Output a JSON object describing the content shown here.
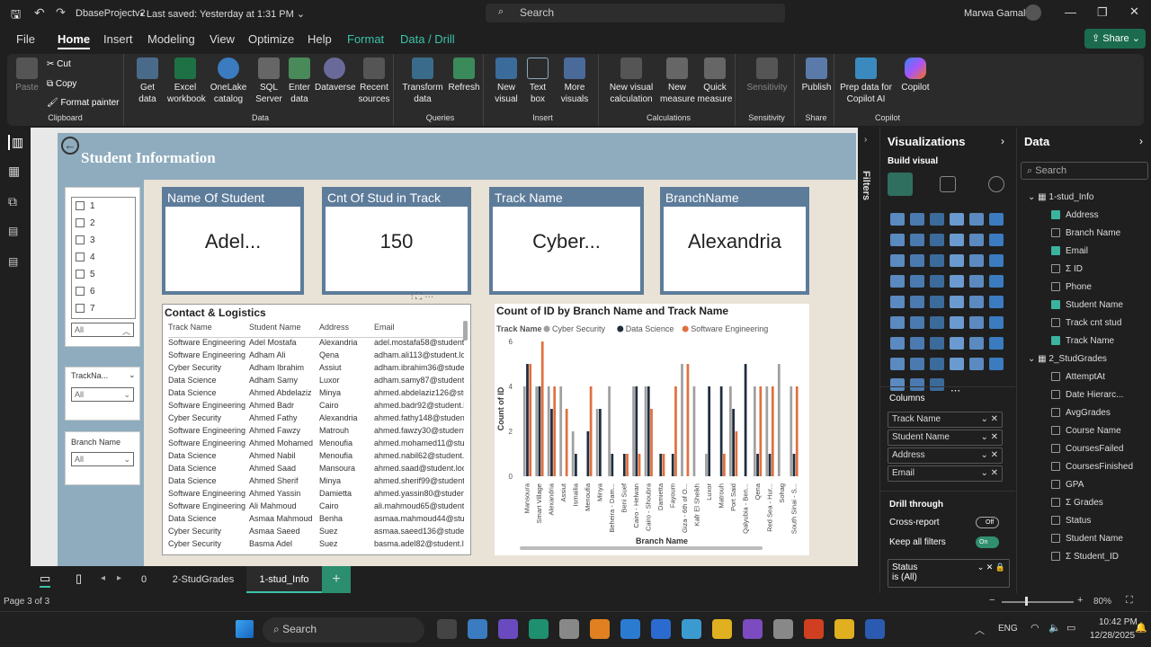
{
  "titlebar": {
    "filename": "DbaseProjectv2",
    "saved": "Last saved: Yesterday at 1:31 PM",
    "search": "Search",
    "user": "Marwa Gamal"
  },
  "menu": [
    "File",
    "Home",
    "Insert",
    "Modeling",
    "View",
    "Optimize",
    "Help",
    "Format",
    "Data / Drill"
  ],
  "share": "Share",
  "ribbon": {
    "clipboard": {
      "label": "Clipboard",
      "paste": "Paste",
      "cut": "Cut",
      "copy": "Copy",
      "format_painter": "Format painter"
    },
    "data": {
      "label": "Data",
      "items": [
        "Get data",
        "Excel workbook",
        "OneLake catalog",
        "SQL Server",
        "Enter data",
        "Dataverse",
        "Recent sources"
      ]
    },
    "queries": {
      "label": "Queries",
      "items": [
        "Transform data",
        "Refresh"
      ]
    },
    "insert": {
      "label": "Insert",
      "items": [
        "New visual",
        "Text box",
        "More visuals"
      ]
    },
    "calculations": {
      "label": "Calculations",
      "items": [
        "New visual calculation",
        "New measure",
        "Quick measure"
      ]
    },
    "sensitivity": {
      "label": "Sensitivity",
      "items": [
        "Sensitivity"
      ]
    },
    "share": {
      "label": "Share",
      "items": [
        "Publish"
      ]
    },
    "copilot": {
      "label": "Copilot",
      "items": [
        "Prep data for Copilot AI",
        "Copilot"
      ]
    }
  },
  "report": {
    "title": "Student Information",
    "cards": [
      {
        "header": "Name Of Student",
        "value": "Adel..."
      },
      {
        "header": "Cnt Of Stud in Track",
        "value": "150"
      },
      {
        "header": "Track Name",
        "value": "Cyber..."
      },
      {
        "header": "BranchName",
        "value": "Alexandria"
      }
    ],
    "id_slicer": {
      "items": [
        "1",
        "2",
        "3",
        "4",
        "5",
        "6",
        "7"
      ],
      "dropdown": "All"
    },
    "track_slicer": {
      "label": "TrackNa...",
      "dropdown": "All"
    },
    "branch_slicer": {
      "label": "Branch Name",
      "dropdown": "All"
    },
    "table": {
      "title": "Contact & Logistics",
      "columns": [
        "Track Name",
        "Student Name",
        "Address",
        "Email"
      ],
      "rows": [
        [
          "Software Engineering",
          "Adel Mostafa",
          "Alexandria",
          "adel.mostafa58@student"
        ],
        [
          "Software Engineering",
          "Adham Ali",
          "Qena",
          "adham.ali113@student.lo"
        ],
        [
          "Cyber Security",
          "Adham Ibrahim",
          "Assiut",
          "adham.ibrahim36@studen"
        ],
        [
          "Data Science",
          "Adham Samy",
          "Luxor",
          "adham.samy87@student."
        ],
        [
          "Data Science",
          "Ahmed Abdelaziz",
          "Minya",
          "ahmed.abdelaziz126@stu"
        ],
        [
          "Software Engineering",
          "Ahmed Badr",
          "Cairo",
          "ahmed.badr92@student.lo"
        ],
        [
          "Cyber Security",
          "Ahmed Fathy",
          "Alexandria",
          "ahmed.fathy148@student"
        ],
        [
          "Software Engineering",
          "Ahmed Fawzy",
          "Matrouh",
          "ahmed.fawzy30@student"
        ],
        [
          "Software Engineering",
          "Ahmed Mohamed",
          "Menoufia",
          "ahmed.mohamed11@stu"
        ],
        [
          "Data Science",
          "Ahmed Nabil",
          "Menoufia",
          "ahmed.nabil62@student."
        ],
        [
          "Data Science",
          "Ahmed Saad",
          "Mansoura",
          "ahmed.saad@student.loc"
        ],
        [
          "Data Science",
          "Ahmed Sherif",
          "Minya",
          "ahmed.sherif99@student"
        ],
        [
          "Software Engineering",
          "Ahmed Yassin",
          "Damietta",
          "ahmed.yassin80@studen"
        ],
        [
          "Software Engineering",
          "Ali Mahmoud",
          "Cairo",
          "ali.mahmoud65@student"
        ],
        [
          "Data Science",
          "Asmaa Mahmoud",
          "Benha",
          "asmaa.mahmoud44@stu"
        ],
        [
          "Cyber Security",
          "Asmaa Saeed",
          "Suez",
          "asmaa.saeed136@studen"
        ],
        [
          "Cyber Security",
          "Basma Adel",
          "Suez",
          "basma.adel82@student.lo"
        ]
      ]
    }
  },
  "chart_data": {
    "type": "bar",
    "title": "Count of ID by Branch Name and Track Name",
    "xlabel": "Branch Name",
    "ylabel": "Count of ID",
    "legend_title": "Track Name",
    "ylim": [
      0,
      6
    ],
    "yticks": [
      0,
      2,
      4,
      6
    ],
    "categories": [
      "Mansoura",
      "Smart Village",
      "Alexandria",
      "Assiut",
      "Ismailia",
      "Menoufia",
      "Minya",
      "Beheira - Dam...",
      "Beni Suef",
      "Cairo - Helwan",
      "Cairo - Shoubra",
      "Damietta",
      "Fayoum",
      "Giza - 6th of O...",
      "Kafr El Sheikh",
      "Luxor",
      "Matrouh",
      "Port Said",
      "Qalyubia - Ben...",
      "Qena",
      "Red Sea - Hur...",
      "Sohag",
      "South Sinai - S..."
    ],
    "series": [
      {
        "name": "Cyber Security",
        "color": "#a0a0a0",
        "values": [
          4,
          4,
          4,
          4,
          2,
          0,
          3,
          4,
          0,
          4,
          4,
          0,
          0,
          5,
          4,
          1,
          0,
          4,
          0,
          4,
          4,
          5,
          4
        ]
      },
      {
        "name": "Data Science",
        "color": "#1f2d3d",
        "values": [
          5,
          4,
          3,
          0,
          1,
          2,
          3,
          1,
          1,
          4,
          4,
          1,
          1,
          0,
          0,
          4,
          4,
          3,
          5,
          1,
          1,
          0,
          1
        ]
      },
      {
        "name": "Software Engineering",
        "color": "#e07040",
        "values": [
          5,
          6,
          4,
          3,
          0,
          4,
          0,
          0,
          1,
          1,
          3,
          1,
          4,
          5,
          0,
          0,
          1,
          2,
          0,
          4,
          4,
          0,
          4
        ]
      }
    ]
  },
  "viz_pane": {
    "title": "Visualizations",
    "build_visual": "Build visual",
    "columns_label": "Columns",
    "columns": [
      "Track Name",
      "Student Name",
      "Address",
      "Email"
    ],
    "drill": "Drill through",
    "cross_report": "Cross-report",
    "cross_report_state": "Off",
    "keep_filters": "Keep all filters",
    "keep_filters_state": "On",
    "status_filter": "Status",
    "status_value": "is (All)"
  },
  "filters_label": "Filters",
  "data_pane": {
    "title": "Data",
    "search": "Search",
    "tables": [
      {
        "name": "1-stud_Info",
        "fields": [
          {
            "name": "Address",
            "checked": true
          },
          {
            "name": "Branch Name",
            "checked": false
          },
          {
            "name": "Email",
            "checked": true
          },
          {
            "name": "ID",
            "checked": false,
            "sigma": true
          },
          {
            "name": "Phone",
            "checked": false
          },
          {
            "name": "Student Name",
            "checked": true
          },
          {
            "name": "Track cnt stud",
            "checked": false
          },
          {
            "name": "Track Name",
            "checked": true
          }
        ]
      },
      {
        "name": "2_StudGrades",
        "fields": [
          {
            "name": "AttemptAt",
            "checked": false
          },
          {
            "name": "Date Hierarc...",
            "checked": false
          },
          {
            "name": "AvgGrades",
            "checked": false
          },
          {
            "name": "Course Name",
            "checked": false
          },
          {
            "name": "CoursesFailed",
            "checked": false
          },
          {
            "name": "CoursesFinished",
            "checked": false
          },
          {
            "name": "GPA",
            "checked": false
          },
          {
            "name": "Grades",
            "checked": false,
            "sigma": true
          },
          {
            "name": "Status",
            "checked": false
          },
          {
            "name": "Student Name",
            "checked": false
          },
          {
            "name": "Student_ID",
            "checked": false,
            "sigma": true
          }
        ]
      }
    ]
  },
  "tabs": {
    "nav_count": "0",
    "pages": [
      "2-StudGrades",
      "1-stud_Info"
    ],
    "active": "1-stud_Info"
  },
  "status": {
    "page": "Page 3 of 3",
    "zoom": "80%"
  },
  "taskbar": {
    "search": "Search",
    "lang": "ENG",
    "time": "10:42 PM",
    "date": "12/28/2025"
  }
}
